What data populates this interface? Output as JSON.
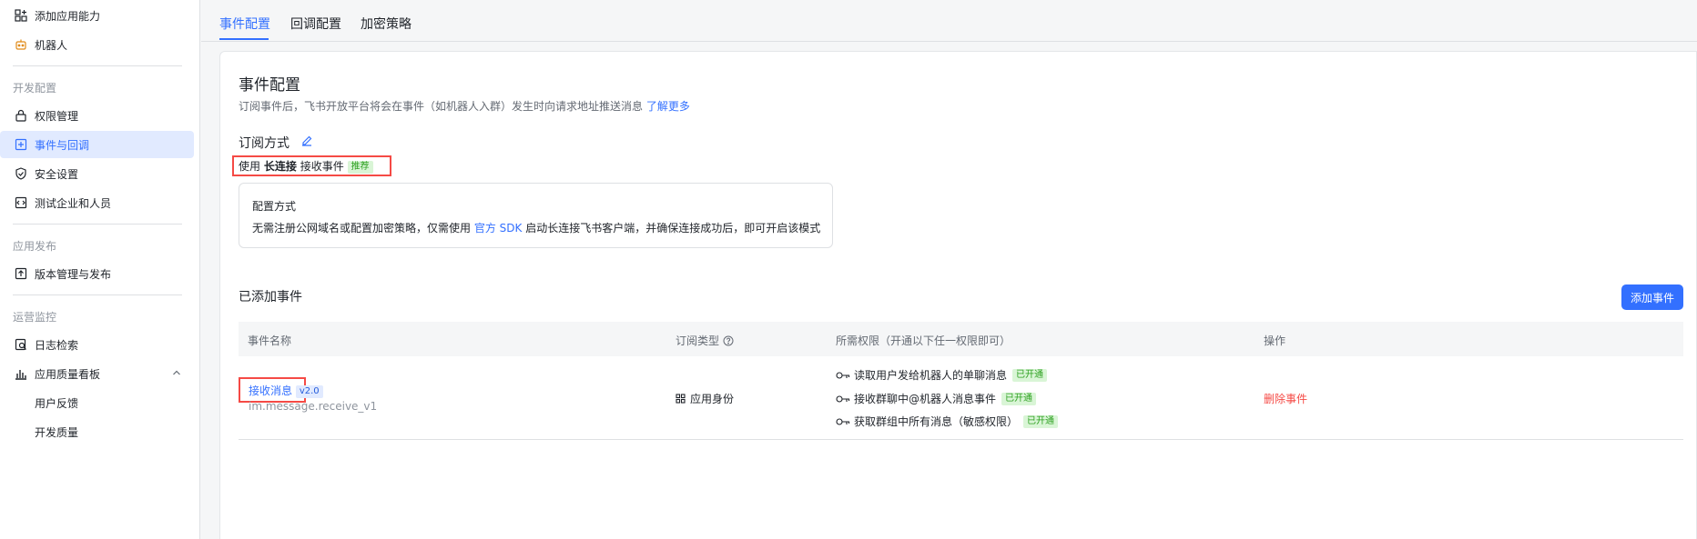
{
  "sidebar": {
    "items_top": [
      {
        "label": "添加应用能力",
        "icon": "grid-plus-icon"
      },
      {
        "label": "机器人",
        "icon": "robot-icon"
      }
    ],
    "groups": [
      {
        "title": "开发配置",
        "items": [
          {
            "label": "权限管理",
            "icon": "lock-icon"
          },
          {
            "label": "事件与回调",
            "icon": "event-icon",
            "active": true
          },
          {
            "label": "安全设置",
            "icon": "shield-check-icon"
          },
          {
            "label": "测试企业和人员",
            "icon": "code-box-icon"
          }
        ]
      },
      {
        "title": "应用发布",
        "items": [
          {
            "label": "版本管理与发布",
            "icon": "upload-box-icon"
          }
        ]
      },
      {
        "title": "运营监控",
        "items": [
          {
            "label": "日志检索",
            "icon": "log-search-icon"
          },
          {
            "label": "应用质量看板",
            "icon": "bar-chart-icon"
          },
          {
            "label": "用户反馈"
          },
          {
            "label": "开发质量"
          }
        ]
      }
    ]
  },
  "tabs": [
    "事件配置",
    "回调配置",
    "加密策略"
  ],
  "card": {
    "title": "事件配置",
    "desc": "订阅事件后，飞书开放平台将会在事件（如机器人入群）发生时向请求地址推送消息",
    "desc_link": "了解更多",
    "sub_title": "订阅方式",
    "method_prefix": "使用",
    "method_bold": "长连接",
    "method_suffix": "接收事件",
    "recommend": "推荐",
    "info_title": "配置方式",
    "info_text_1": "无需注册公网域名或配置加密策略，仅需使用",
    "info_link": "官方 SDK",
    "info_text_2": "启动长连接飞书客户端，并确保连接成功后，即可开启该模式",
    "added_title": "已添加事件",
    "add_button": "添加事件"
  },
  "table": {
    "headers": [
      "事件名称",
      "订阅类型",
      "所需权限（开通以下任一权限即可）",
      "操作"
    ],
    "rows": [
      {
        "name": "接收消息",
        "version": "v2.0",
        "code": "im.message.receive_v1",
        "type": "应用身份",
        "permissions": [
          {
            "label": "读取用户发给机器人的单聊消息",
            "status": "已开通"
          },
          {
            "label": "接收群聊中@机器人消息事件",
            "status": "已开通"
          },
          {
            "label": "获取群组中所有消息（敏感权限）",
            "status": "已开通"
          }
        ],
        "action": "删除事件"
      }
    ]
  },
  "colors": {
    "accent": "#3370ff",
    "danger": "#f54a45",
    "success": "#2ea121"
  }
}
